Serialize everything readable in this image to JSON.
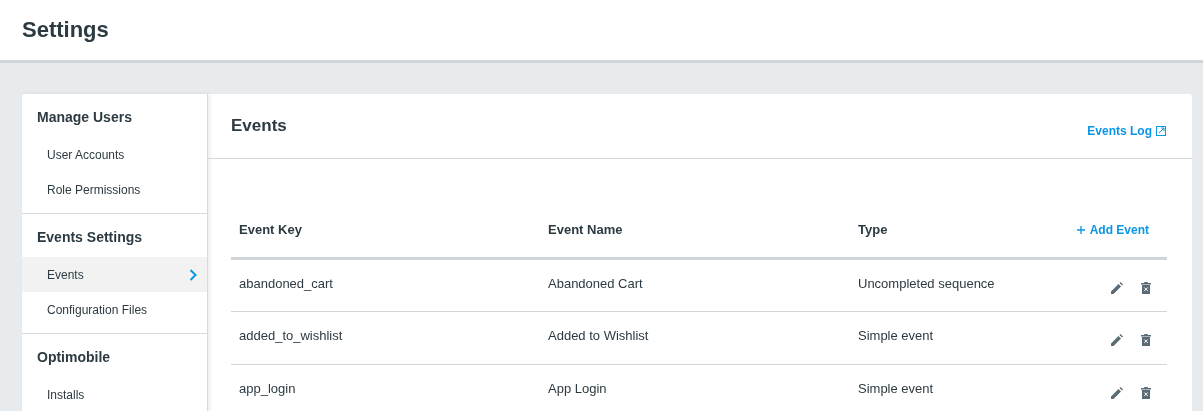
{
  "page_title": "Settings",
  "sidebar": {
    "sections": [
      {
        "title": "Manage Users",
        "items": [
          {
            "label": "User Accounts",
            "selected": false
          },
          {
            "label": "Role Permissions",
            "selected": false
          }
        ]
      },
      {
        "title": "Events Settings",
        "items": [
          {
            "label": "Events",
            "selected": true
          },
          {
            "label": "Configuration Files",
            "selected": false
          }
        ]
      },
      {
        "title": "Optimobile",
        "items": [
          {
            "label": "Installs",
            "selected": false
          }
        ]
      }
    ]
  },
  "panel": {
    "title": "Events",
    "log_link": "Events Log"
  },
  "table": {
    "columns": [
      "Event Key",
      "Event Name",
      "Type"
    ],
    "add_button": "Add Event",
    "rows": [
      {
        "key": "abandoned_cart",
        "name": "Abandoned Cart",
        "type": "Uncompleted sequence"
      },
      {
        "key": "added_to_wishlist",
        "name": "Added to Wishlist",
        "type": "Simple event"
      },
      {
        "key": "app_login",
        "name": "App Login",
        "type": "Simple event"
      }
    ]
  }
}
